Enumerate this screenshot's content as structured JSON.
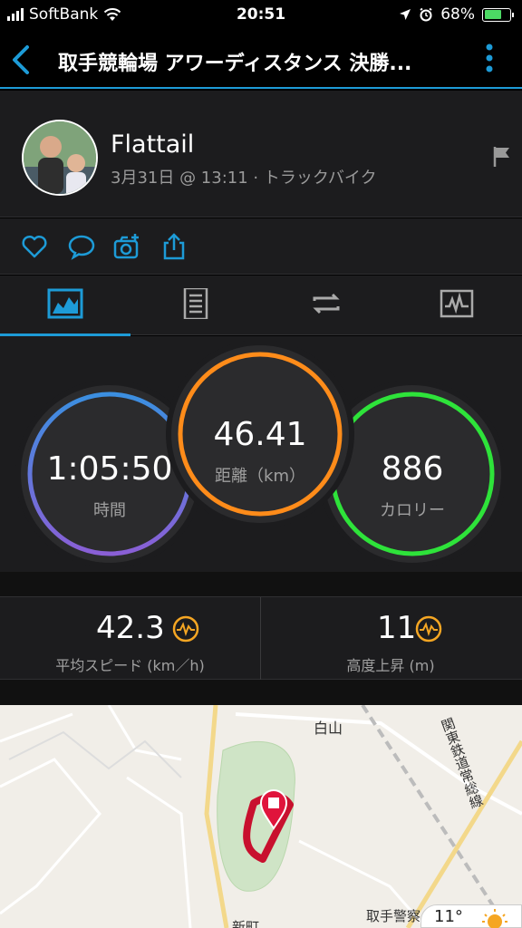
{
  "status": {
    "carrier": "SoftBank",
    "time": "20:51",
    "battery": "68%",
    "battery_level": 0.68
  },
  "header": {
    "title": "取手競輪場 アワーディスタンス 決勝..."
  },
  "profile": {
    "name": "Flattail",
    "meta": "3月31日 @ 13:11 · トラックバイク"
  },
  "actions": [
    "heart-icon",
    "comment-icon",
    "camera-icon",
    "share-icon"
  ],
  "tabs": [
    "overview",
    "details",
    "laps",
    "charts"
  ],
  "stats": {
    "time": {
      "value": "1:05:50",
      "label": "時間"
    },
    "distance": {
      "value": "46.41",
      "label": "距離（km）"
    },
    "calories": {
      "value": "886",
      "label": "カロリー"
    }
  },
  "metrics": {
    "speed": {
      "value": "42.3",
      "label": "平均スピード (km／h)"
    },
    "elevation": {
      "value": "11",
      "label": "高度上昇 (m)"
    }
  },
  "map": {
    "label_hakusan": "白山",
    "label_rail": "関東鉄道常総線",
    "label_police": "取手警察",
    "label_town": "新町",
    "temperature": "11°"
  },
  "colors": {
    "accent": "#1d9bd7",
    "time_ring_top": "#3b8fe0",
    "time_ring_bottom": "#8a5fd6",
    "distance_ring": "#ff8c1a",
    "calories_ring": "#2ee33a",
    "route": "#c8102e"
  }
}
